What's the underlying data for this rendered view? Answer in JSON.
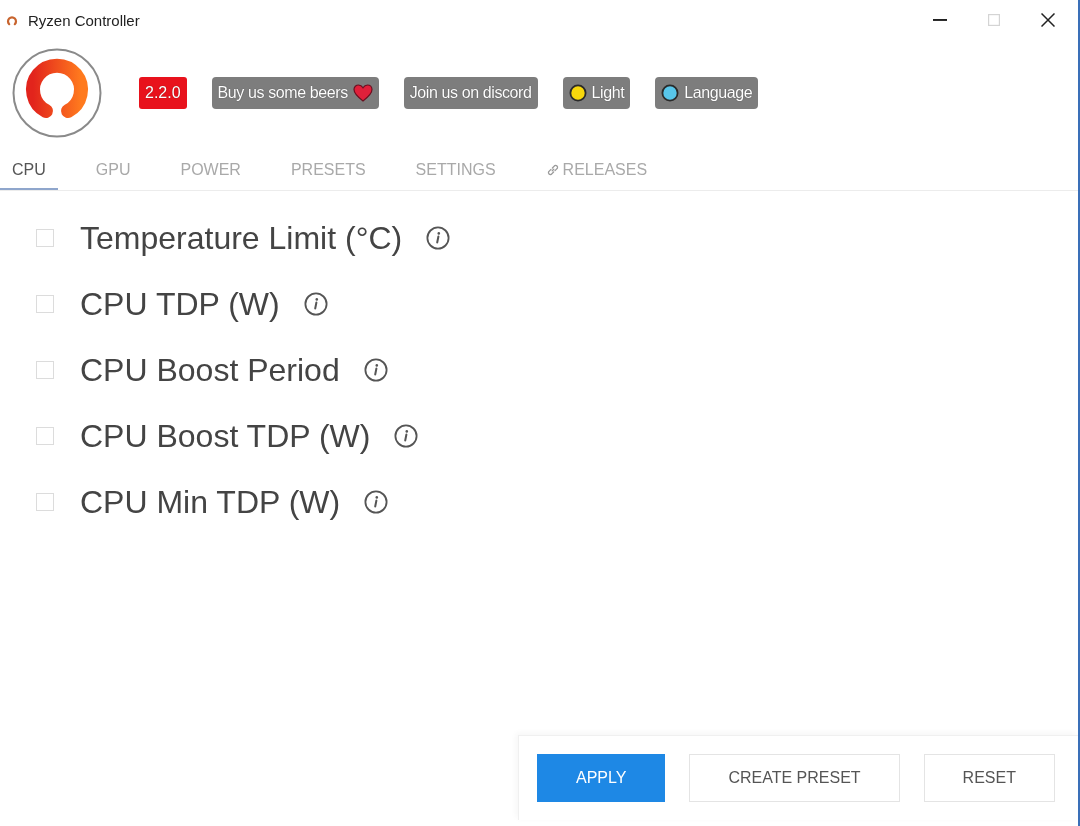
{
  "window": {
    "title": "Ryzen Controller",
    "controls": [
      {
        "kind": "minimize",
        "disabled": false
      },
      {
        "kind": "maximize",
        "disabled": true
      },
      {
        "kind": "close",
        "disabled": false
      }
    ]
  },
  "header": {
    "version": "2.2.0",
    "links": [
      {
        "label": "Buy us some beers",
        "kind": "heart"
      },
      {
        "label": "Join us on discord",
        "kind": "plain"
      },
      {
        "label": "Light",
        "kind": "dot",
        "color": "#f7d70c"
      },
      {
        "label": "Language",
        "kind": "dot",
        "color": "#58c6ea"
      }
    ]
  },
  "tabs": [
    {
      "label": "CPU",
      "kind": "plain",
      "selected": true
    },
    {
      "label": "GPU",
      "kind": "plain",
      "selected": false
    },
    {
      "label": "POWER",
      "kind": "plain",
      "selected": false
    },
    {
      "label": "PRESETS",
      "kind": "plain",
      "selected": false
    },
    {
      "label": "SETTINGS",
      "kind": "plain",
      "selected": false
    },
    {
      "label": "RELEASES",
      "kind": "link",
      "selected": false
    }
  ],
  "settings": [
    {
      "label": "Temperature Limit (°C)",
      "checked": false
    },
    {
      "label": "CPU TDP (W)",
      "checked": false
    },
    {
      "label": "CPU Boost Period",
      "checked": false
    },
    {
      "label": "CPU Boost TDP (W)",
      "checked": false
    },
    {
      "label": "CPU Min TDP (W)",
      "checked": false
    }
  ],
  "actions": [
    {
      "label": "APPLY",
      "kind": "primary"
    },
    {
      "label": "CREATE PRESET",
      "kind": "outline"
    },
    {
      "label": "RESET",
      "kind": "outline"
    }
  ]
}
